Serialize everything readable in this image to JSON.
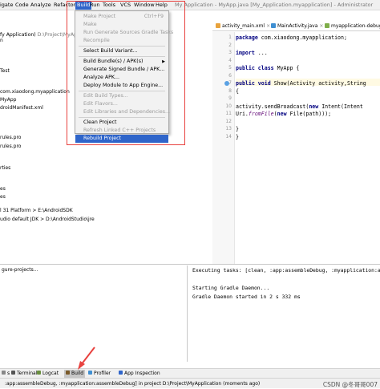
{
  "menubar": {
    "items": [
      "igate",
      "Code",
      "Analyze",
      "Refactor",
      "Build",
      "Run",
      "Tools",
      "VCS",
      "Window",
      "Help"
    ],
    "title": "My Application - MyApp.java [My_Application.myapplication] - Administrator"
  },
  "breadcrumb": {
    "project": "fy Application)",
    "path": "D:\\Project\\MyApp"
  },
  "editor_tabs": [
    {
      "label": "activity_main.xml",
      "color": "#e8a33d"
    },
    {
      "label": "MainActivity.java",
      "color": "#3f8fd2"
    },
    {
      "label": "myapplication-debug...",
      "color": "#7fae4a"
    }
  ],
  "build_menu": {
    "items": [
      {
        "label": "Make Project",
        "shortcut": "Ctrl+F9",
        "disabled": true
      },
      {
        "label": "Make",
        "disabled": true
      },
      {
        "label": "Run Generate Sources Gradle Tasks",
        "disabled": true
      },
      {
        "label": "Recompile",
        "disabled": true
      },
      {
        "label": "Select Build Variant...",
        "disabled": false,
        "sep_before": true
      },
      {
        "label": "Build Bundle(s) / APK(s)",
        "disabled": false,
        "submenu": true,
        "sep_before": true
      },
      {
        "label": "Generate Signed Bundle / APK...",
        "disabled": false
      },
      {
        "label": "Analyze APK...",
        "disabled": false
      },
      {
        "label": "Deploy Module to App Engine...",
        "disabled": false
      },
      {
        "label": "Edit Build Types...",
        "disabled": true,
        "sep_before": true
      },
      {
        "label": "Edit Flavors...",
        "disabled": true
      },
      {
        "label": "Edit Libraries and Dependencies...",
        "disabled": true
      },
      {
        "label": "Clean Project",
        "disabled": false,
        "sep_before": true
      },
      {
        "label": "Refresh Linked C++ Projects",
        "disabled": true
      },
      {
        "label": "Rebuild Project",
        "disabled": false,
        "selected": true
      }
    ]
  },
  "project_tree": [
    "n",
    "Test",
    "com.xiaodong.myapplication",
    "MyApp",
    "droidManifest.xml",
    "rules.pro",
    "rules.pro",
    "rties",
    "es",
    "es",
    "l 31 Platform > E:\\AndroidSDK",
    "udio default JDK > D:\\AndroidStudio\\jre"
  ],
  "editor": {
    "lines": [
      {
        "parts": [
          {
            "t": "package ",
            "c": "kw"
          },
          {
            "t": "com.xiaodong.myapplication;",
            "c": "type"
          }
        ]
      },
      {
        "parts": []
      },
      {
        "parts": [
          {
            "t": "import ",
            "c": "kw"
          },
          {
            "t": "...",
            "c": "type"
          }
        ]
      },
      {
        "parts": []
      },
      {
        "parts": [
          {
            "t": "public class ",
            "c": "kw"
          },
          {
            "t": "MyApp {",
            "c": "type"
          }
        ]
      },
      {
        "parts": []
      },
      {
        "parts": [
          {
            "t": "    public void ",
            "c": "kw"
          },
          {
            "t": "Show(Activity activity,String",
            "c": "type"
          }
        ]
      },
      {
        "parts": [
          {
            "t": "    {",
            "c": "type"
          }
        ]
      },
      {
        "parts": []
      },
      {
        "parts": [
          {
            "t": "        activity.sendBroadcast(",
            "c": "type"
          },
          {
            "t": "new ",
            "c": "kw"
          },
          {
            "t": "Intent(Intent",
            "c": "type"
          }
        ]
      },
      {
        "parts": [
          {
            "t": "                Uri.",
            "c": "type"
          },
          {
            "t": "fromFile",
            "c": "fld"
          },
          {
            "t": "(",
            "c": "type"
          },
          {
            "t": "new ",
            "c": "kw"
          },
          {
            "t": "File(path)));",
            "c": "type"
          }
        ]
      },
      {
        "parts": []
      },
      {
        "parts": [
          {
            "t": "    }",
            "c": "type"
          }
        ]
      },
      {
        "parts": [
          {
            "t": "}",
            "c": "type"
          }
        ]
      }
    ],
    "line_numbers": [
      "1",
      "2",
      "3",
      "4",
      "5",
      "6",
      "7",
      "8",
      "9",
      "10",
      "11",
      "12",
      "13",
      "14"
    ]
  },
  "build_output": {
    "left_line": "gure-projects...",
    "right_lines": [
      "Executing tasks: [clean, :app:assembleDebug, :myapplication:ass",
      "",
      "Starting Gradle Daemon...",
      "Gradle Daemon started in 2 s 332 ms"
    ]
  },
  "toolwindows": [
    {
      "label": "s",
      "icon": "list-icon"
    },
    {
      "label": "Terminal",
      "icon": "terminal-icon"
    },
    {
      "label": "Logcat",
      "icon": "logcat-icon"
    },
    {
      "label": "Build",
      "icon": "hammer-icon",
      "selected": true
    },
    {
      "label": "Profiler",
      "icon": "profiler-icon"
    },
    {
      "label": "App Inspection",
      "icon": "inspection-icon"
    }
  ],
  "statusbar": {
    "text": ":app:assembleDebug, :myapplication:assembleDebug] in project D:\\Project\\MyApplication (moments ago)",
    "watermark": "CSDN @冬哥哥007"
  },
  "colors": {
    "accent": "#2f65ca",
    "annotation": "#e8423f"
  }
}
